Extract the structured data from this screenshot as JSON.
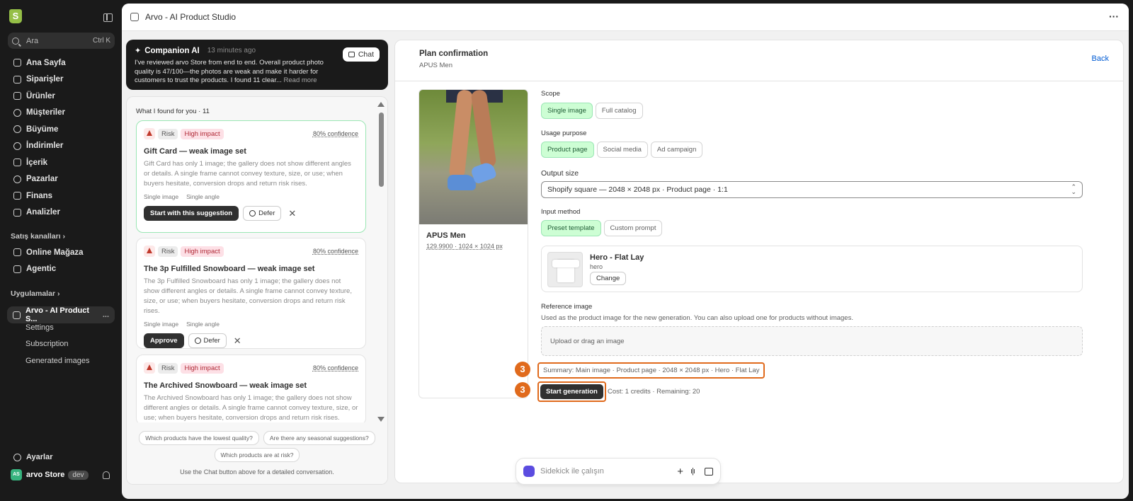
{
  "sidebar": {
    "search": {
      "placeholder": "Ara",
      "shortcut": "Ctrl K"
    },
    "items": [
      {
        "label": "Ana Sayfa",
        "icon": "home-icon"
      },
      {
        "label": "Siparişler",
        "icon": "orders-icon"
      },
      {
        "label": "Ürünler",
        "icon": "tag-icon"
      },
      {
        "label": "Müşteriler",
        "icon": "person-icon"
      },
      {
        "label": "Büyüme",
        "icon": "growth-icon"
      },
      {
        "label": "İndirimler",
        "icon": "discount-icon"
      },
      {
        "label": "İçerik",
        "icon": "content-icon"
      },
      {
        "label": "Pazarlar",
        "icon": "globe-icon"
      },
      {
        "label": "Finans",
        "icon": "bank-icon"
      },
      {
        "label": "Analizler",
        "icon": "chart-icon"
      }
    ],
    "sales_channels_label": "Satış kanalları",
    "sales_channels": [
      {
        "label": "Online Mağaza",
        "icon": "store-icon"
      },
      {
        "label": "Agentic",
        "icon": "agentic-icon"
      }
    ],
    "apps_label": "Uygulamalar",
    "app": {
      "label": "Arvo - AI Product S...",
      "more": "..."
    },
    "app_sub": [
      "Settings",
      "Subscription",
      "Generated images"
    ],
    "settings_label": "Ayarlar",
    "store": {
      "avatar": "AS",
      "name": "arvo Store",
      "badge": "dev"
    }
  },
  "topbar": {
    "title": "Arvo - AI Product Studio",
    "more": "···"
  },
  "companion": {
    "title": "Companion AI",
    "time": "13 minutes ago",
    "chat_label": "Chat",
    "body": "I've reviewed arvo Store from end to end. Overall product photo quality is 47/100—the photos are weak and make it harder for customers to trust the products. I found 11 clear...",
    "read_more": "Read more"
  },
  "suggestions": {
    "header": "What I found for you · 11",
    "cards": [
      {
        "risk": "Risk",
        "impact": "High impact",
        "confidence": "80% confidence",
        "title": "Gift Card — weak image set",
        "desc": "Gift Card has only 1 image; the gallery does not show different angles or details. A single frame cannot convey texture, size, or use; when buyers hesitate, conversion drops and return risk rises.",
        "tags": [
          "Single image",
          "Single angle"
        ],
        "primary": "Start with this suggestion",
        "secondary": "Defer"
      },
      {
        "risk": "Risk",
        "impact": "High impact",
        "confidence": "80% confidence",
        "title": "The 3p Fulfilled Snowboard — weak image set",
        "desc": "The 3p Fulfilled Snowboard has only 1 image; the gallery does not show different angles or details. A single frame cannot convey texture, size, or use; when buyers hesitate, conversion drops and return risk rises.",
        "tags": [
          "Single image",
          "Single angle"
        ],
        "primary": "Approve",
        "secondary": "Defer"
      },
      {
        "risk": "Risk",
        "impact": "High impact",
        "confidence": "80% confidence",
        "title": "The Archived Snowboard — weak image set",
        "desc": "The Archived Snowboard has only 1 image; the gallery does not show different angles or details. A single frame cannot convey texture, size, or use; when buyers hesitate, conversion drops and return risk rises."
      }
    ],
    "quick_questions": [
      "Which products have the lowest quality?",
      "Are there any seasonal suggestions?",
      "Which products are at risk?"
    ],
    "note": "Use the Chat button above for a detailed conversation."
  },
  "plan": {
    "title": "Plan confirmation",
    "subtitle": "APUS Men",
    "back": "Back",
    "product": {
      "name": "APUS Men",
      "meta": "129.9900 · 1024 × 1024 px"
    },
    "scope": {
      "label": "Scope",
      "options": [
        "Single image",
        "Full catalog"
      ],
      "selected": "Single image"
    },
    "usage": {
      "label": "Usage purpose",
      "options": [
        "Product page",
        "Social media",
        "Ad campaign"
      ],
      "selected": "Product page"
    },
    "output": {
      "label": "Output size",
      "value": "Shopify square — 2048 × 2048 px · Product page · 1:1"
    },
    "input": {
      "label": "Input method",
      "options": [
        "Preset template",
        "Custom prompt"
      ],
      "selected": "Preset template"
    },
    "template": {
      "name": "Hero - Flat Lay",
      "sub": "hero",
      "change": "Change"
    },
    "reference": {
      "label": "Reference image",
      "help": "Used as the product image for the new generation. You can also upload one for products without images.",
      "dropzone": "Upload or drag an image"
    },
    "summary": "Summary: Main image · Product page · 2048 × 2048 px · Hero · Flat Lay",
    "start": "Start generation",
    "cost": "Cost: 1 credits · Remaining: 20",
    "step_badge": "3"
  },
  "sidekick": {
    "placeholder": "Sidekick ile çalışın"
  },
  "colors": {
    "accent_green": "#cdfed4",
    "highlight_orange": "#e06a1c",
    "link_blue": "#005bd3",
    "sidebar_bg": "#1a1a1a"
  }
}
